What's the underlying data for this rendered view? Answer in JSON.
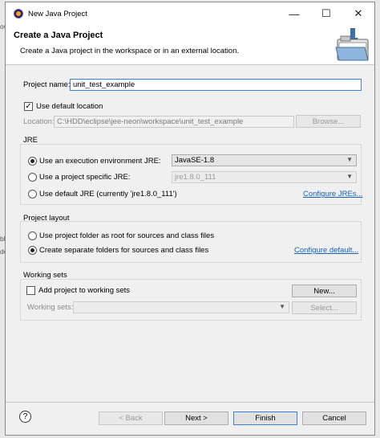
{
  "background": {
    "texts": [
      "ow",
      "bl",
      "de"
    ]
  },
  "window": {
    "title": "New Java Project",
    "controls": {
      "minimize": "—",
      "maximize": "☐",
      "close": "✕"
    }
  },
  "header": {
    "title": "Create a Java Project",
    "description": "Create a Java project in the workspace or in an external location."
  },
  "project": {
    "name_label": "Project name:",
    "name_value": "unit_test_example",
    "use_default_location": "Use default location",
    "location_label": "Location:",
    "location_value": "C:\\HDD\\eclipse\\jee-neon\\workspace\\unit_test_example",
    "browse": "Browse..."
  },
  "jre": {
    "title": "JRE",
    "option_env": "Use an execution environment JRE:",
    "env_value": "JavaSE-1.8",
    "option_specific": "Use a project specific JRE:",
    "specific_value": "jre1.8.0_111",
    "option_default": "Use default JRE (currently 'jre1.8.0_111')",
    "configure": "Configure JREs..."
  },
  "layout": {
    "title": "Project layout",
    "option_root": "Use project folder as root for sources and class files",
    "option_separate": "Create separate folders for sources and class files",
    "configure": "Configure default..."
  },
  "working_sets": {
    "title": "Working sets",
    "add_label": "Add project to working sets",
    "new": "New...",
    "sets_label": "Working sets:",
    "select": "Select..."
  },
  "footer": {
    "help": "?",
    "back": "< Back",
    "next": "Next >",
    "finish": "Finish",
    "cancel": "Cancel"
  }
}
